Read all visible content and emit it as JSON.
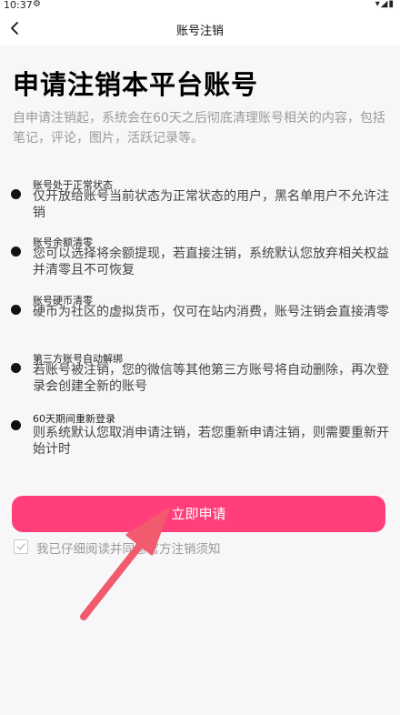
{
  "status_bar": {
    "time": "10:37",
    "gear_icon": "settings-gear-icon",
    "right_icons": "wifi-icon signal-icon battery-icon"
  },
  "nav": {
    "back_icon": "chevron-left-icon",
    "title": "账号注销"
  },
  "page_title": "申请注销本平台账号",
  "intro": "自申请注销起，系统会在60天之后彻底清理账号相关的内容，包括笔记，评论，图片，活跃记录等。",
  "conditions": [
    {
      "title": "账号处于正常状态",
      "desc": "仅开放给账号当前状态为正常状态的用户，黑名单用户不允许注销"
    },
    {
      "title": "账号余额清零",
      "desc": "您可以选择将余额提现，若直接注销，系统默认您放弃相关权益并清零且不可恢复"
    },
    {
      "title": "账号硬币清零",
      "desc": "硬币为社区的虚拟货币，仅可在站内消费，账号注销会直接清零"
    },
    {
      "title": "第三方账号自动解绑",
      "desc": "若账号被注销，您的微信等其他第三方账号将自动删除，再次登录会创建全新的账号"
    },
    {
      "title": "60天期间重新登录",
      "desc": "则系统默认您取消申请注销，若您重新申请注销，则需要重新开始计时"
    }
  ],
  "apply_button": "立即申请",
  "agreement": "我已仔细阅读并同意官方注销须知",
  "colors": {
    "accent": "#ff3e7a",
    "arrow": "#f25a6e",
    "muted": "#9a9a9a"
  }
}
